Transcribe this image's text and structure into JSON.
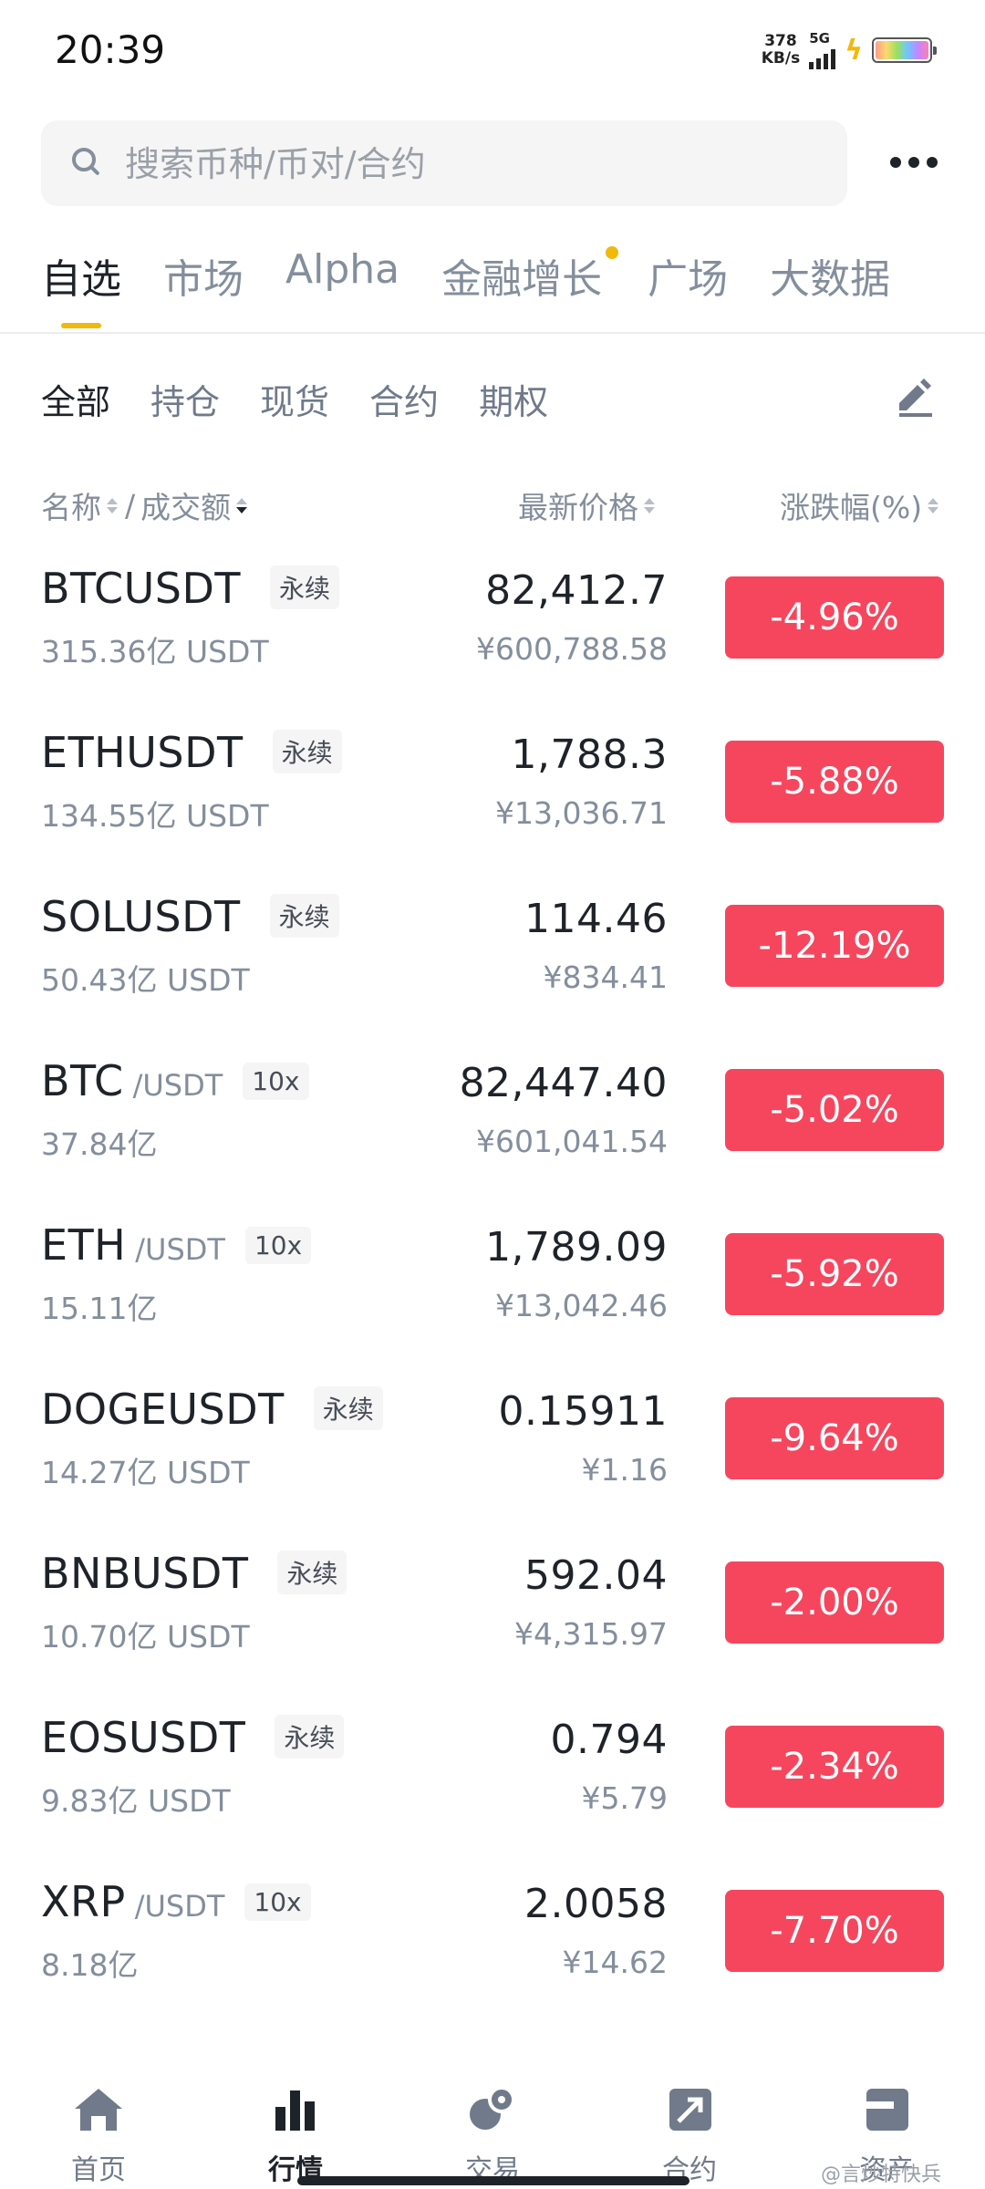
{
  "status_bar": {
    "time": "20:39",
    "net_speed_value": "378",
    "net_speed_unit": "KB/s",
    "network": "5G"
  },
  "search": {
    "placeholder": "搜索币种/币对/合约"
  },
  "main_tabs": [
    {
      "label": "自选",
      "active": true
    },
    {
      "label": "市场"
    },
    {
      "label": "Alpha"
    },
    {
      "label": "金融增长",
      "badge_dot": true
    },
    {
      "label": "广场"
    },
    {
      "label": "大数据"
    }
  ],
  "sub_tabs": [
    {
      "label": "全部",
      "active": true
    },
    {
      "label": "持仓"
    },
    {
      "label": "现货"
    },
    {
      "label": "合约"
    },
    {
      "label": "期权"
    }
  ],
  "columns": {
    "name": "名称",
    "separator": "/",
    "volume": "成交额",
    "price": "最新价格",
    "change": "涨跌幅(%)"
  },
  "rows": [
    {
      "symbol": "BTCUSDT",
      "quote": "",
      "tag": "永续",
      "volume": "315.36亿 USDT",
      "price": "82,412.7",
      "cny": "¥600,788.58",
      "change": "-4.96%"
    },
    {
      "symbol": "ETHUSDT",
      "quote": "",
      "tag": "永续",
      "volume": "134.55亿 USDT",
      "price": "1,788.3",
      "cny": "¥13,036.71",
      "change": "-5.88%"
    },
    {
      "symbol": "SOLUSDT",
      "quote": "",
      "tag": "永续",
      "volume": "50.43亿 USDT",
      "price": "114.46",
      "cny": "¥834.41",
      "change": "-12.19%"
    },
    {
      "symbol": "BTC",
      "quote": "/USDT",
      "tag": "10x",
      "volume": "37.84亿",
      "price": "82,447.40",
      "cny": "¥601,041.54",
      "change": "-5.02%"
    },
    {
      "symbol": "ETH",
      "quote": "/USDT",
      "tag": "10x",
      "volume": "15.11亿",
      "price": "1,789.09",
      "cny": "¥13,042.46",
      "change": "-5.92%"
    },
    {
      "symbol": "DOGEUSDT",
      "quote": "",
      "tag": "永续",
      "volume": "14.27亿 USDT",
      "price": "0.15911",
      "cny": "¥1.16",
      "change": "-9.64%"
    },
    {
      "symbol": "BNBUSDT",
      "quote": "",
      "tag": "永续",
      "volume": "10.70亿 USDT",
      "price": "592.04",
      "cny": "¥4,315.97",
      "change": "-2.00%"
    },
    {
      "symbol": "EOSUSDT",
      "quote": "",
      "tag": "永续",
      "volume": "9.83亿 USDT",
      "price": "0.794",
      "cny": "¥5.79",
      "change": "-2.34%"
    },
    {
      "symbol": "XRP",
      "quote": "/USDT",
      "tag": "10x",
      "volume": "8.18亿",
      "price": "2.0058",
      "cny": "¥14.62",
      "change": "-7.70%"
    }
  ],
  "bottom_nav": [
    {
      "label": "首页",
      "icon": "home-icon"
    },
    {
      "label": "行情",
      "icon": "markets-icon",
      "active": true
    },
    {
      "label": "交易",
      "icon": "trade-icon"
    },
    {
      "label": "合约",
      "icon": "futures-icon"
    },
    {
      "label": "资产",
      "icon": "wallet-icon"
    }
  ],
  "watermark": "@言炒特快兵",
  "colors": {
    "accent": "#f0b90b",
    "down": "#f6465d",
    "text": "#1e2329",
    "muted": "#848e9c"
  }
}
